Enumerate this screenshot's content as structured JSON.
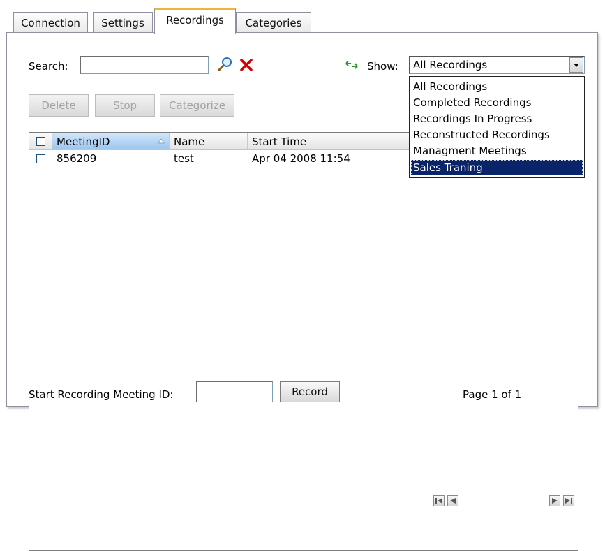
{
  "tabs": [
    {
      "label": "Connection"
    },
    {
      "label": "Settings"
    },
    {
      "label": "Recordings"
    },
    {
      "label": "Categories"
    }
  ],
  "active_tab": "Recordings",
  "search": {
    "label": "Search:",
    "value": ""
  },
  "show": {
    "label": "Show:",
    "selected": "All Recordings",
    "options": [
      "All Recordings",
      "Completed Recordings",
      "Recordings In Progress",
      "Reconstructed Recordings",
      "Managment Meetings",
      "Sales Traning"
    ],
    "highlighted": "Sales Traning"
  },
  "toolbar": {
    "delete": "Delete",
    "stop": "Stop",
    "categorize": "Categorize"
  },
  "grid": {
    "columns": [
      "MeetingID",
      "Name",
      "Start Time"
    ],
    "sorted_column": "MeetingID",
    "rows": [
      {
        "meeting_id": "856209",
        "name": "test",
        "start_time": "Apr 04 2008 11:54"
      }
    ]
  },
  "footer": {
    "start_label": "Start Recording Meeting ID:",
    "meeting_id_value": "",
    "record": "Record",
    "page_text": "Page 1 of 1"
  },
  "icons": [
    "magnifier-icon",
    "clear-x-icon",
    "refresh-icon",
    "first-page-icon",
    "prev-page-icon",
    "next-page-icon",
    "last-page-icon"
  ],
  "colors": {
    "active_tab_accent": "#f2b23d",
    "selected_option_bg": "#0a246a",
    "sorted_header": "#9cc5ee",
    "clear_x": "#d40000",
    "refresh": "#2f9a2f"
  }
}
